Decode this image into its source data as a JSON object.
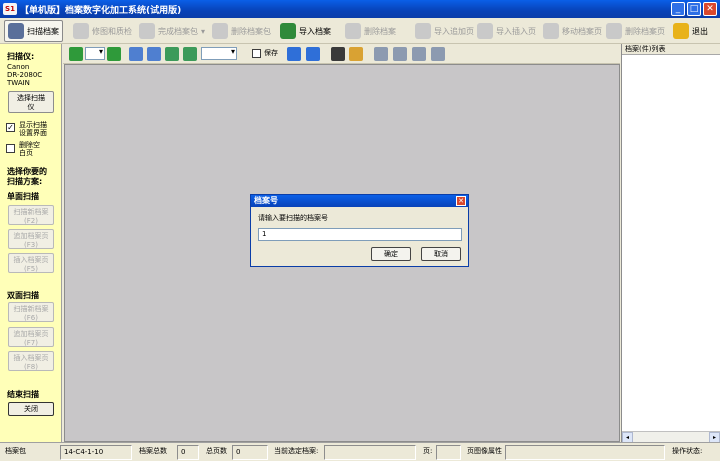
{
  "window": {
    "icon_text": "S1",
    "title": "【单机版】档案数字化加工系统(试用版)",
    "minimize": "_",
    "maximize": "□",
    "close": "✕"
  },
  "toolbar": {
    "items": [
      {
        "label": "扫描档案",
        "icon": "scanner-icon",
        "enabled": true,
        "active": true
      },
      {
        "label": "修图和质检",
        "icon": "edit-image-icon",
        "enabled": false
      },
      {
        "label": "完成档案包",
        "icon": "package-icon",
        "enabled": false
      },
      {
        "label": "删除档案包",
        "icon": "delete-package-icon",
        "enabled": false
      },
      {
        "label": "导入档案",
        "icon": "import-icon",
        "enabled": true
      },
      {
        "label": "删除档案",
        "icon": "delete-icon",
        "enabled": false
      },
      {
        "label": "导入追加页",
        "icon": "append-page-icon",
        "enabled": false
      },
      {
        "label": "导入插入页",
        "icon": "insert-page-icon",
        "enabled": false
      },
      {
        "label": "移动档案页",
        "icon": "move-page-icon",
        "enabled": false
      },
      {
        "label": "删除档案页",
        "icon": "delete-page-icon",
        "enabled": false
      },
      {
        "label": "退出",
        "icon": "exit-icon",
        "enabled": true
      }
    ]
  },
  "left_panel": {
    "scanner_label": "扫描仪:",
    "scanner_name_line1": "Canon",
    "scanner_name_line2": "DR-2080C",
    "scanner_name_line3": "TWAIN",
    "select_scanner_line1": "选择扫描",
    "select_scanner_line2": "仪",
    "show_ui_line1": "显示扫描",
    "show_ui_line2": "设置界面",
    "show_ui_checked": true,
    "delete_blank_line1": "删除空",
    "delete_blank_line2": "白页",
    "delete_blank_checked": false,
    "choose_heading_line1": "选择你要的",
    "choose_heading_line2": "扫描方案:",
    "single_heading": "单面扫描",
    "single_buttons": [
      {
        "line1": "扫描新档案",
        "line2": "(F2)"
      },
      {
        "line1": "追加档案页",
        "line2": "(F3)"
      },
      {
        "line1": "插入档案页",
        "line2": "(F5)"
      }
    ],
    "duplex_heading": "双面扫描",
    "duplex_buttons": [
      {
        "line1": "扫描新档案",
        "line2": "(F6)"
      },
      {
        "line1": "追加档案页",
        "line2": "(F7)"
      },
      {
        "line1": "插入档案页",
        "line2": "(F8)"
      }
    ],
    "end_heading": "结束扫描",
    "close_label": "关闭"
  },
  "toolbar2": {
    "save_label": "保存",
    "save_checked": false
  },
  "right_panel": {
    "header": "档案(件)列表"
  },
  "dialog": {
    "title": "档案号",
    "prompt": "请输入要扫描的档案号",
    "input_value": "1",
    "ok_label": "确定",
    "cancel_label": "取消"
  },
  "status_bar": {
    "package_label": "档案包",
    "package_value": "14-C4-1-10",
    "total_label": "档案总数",
    "total_value": "0",
    "pages_label": "总页数",
    "pages_value": "0",
    "current_label": "当前选定档案:",
    "current_value": "",
    "page_label": "页:",
    "page_attr_label": "页图像属性",
    "op_status_label": "操作状态:"
  },
  "colors": {
    "title_bar": "#0842b8",
    "left_panel_bg": "#ffffb8",
    "canvas_bg": "#c8c6c8",
    "chrome_bg": "#ece9d8"
  }
}
